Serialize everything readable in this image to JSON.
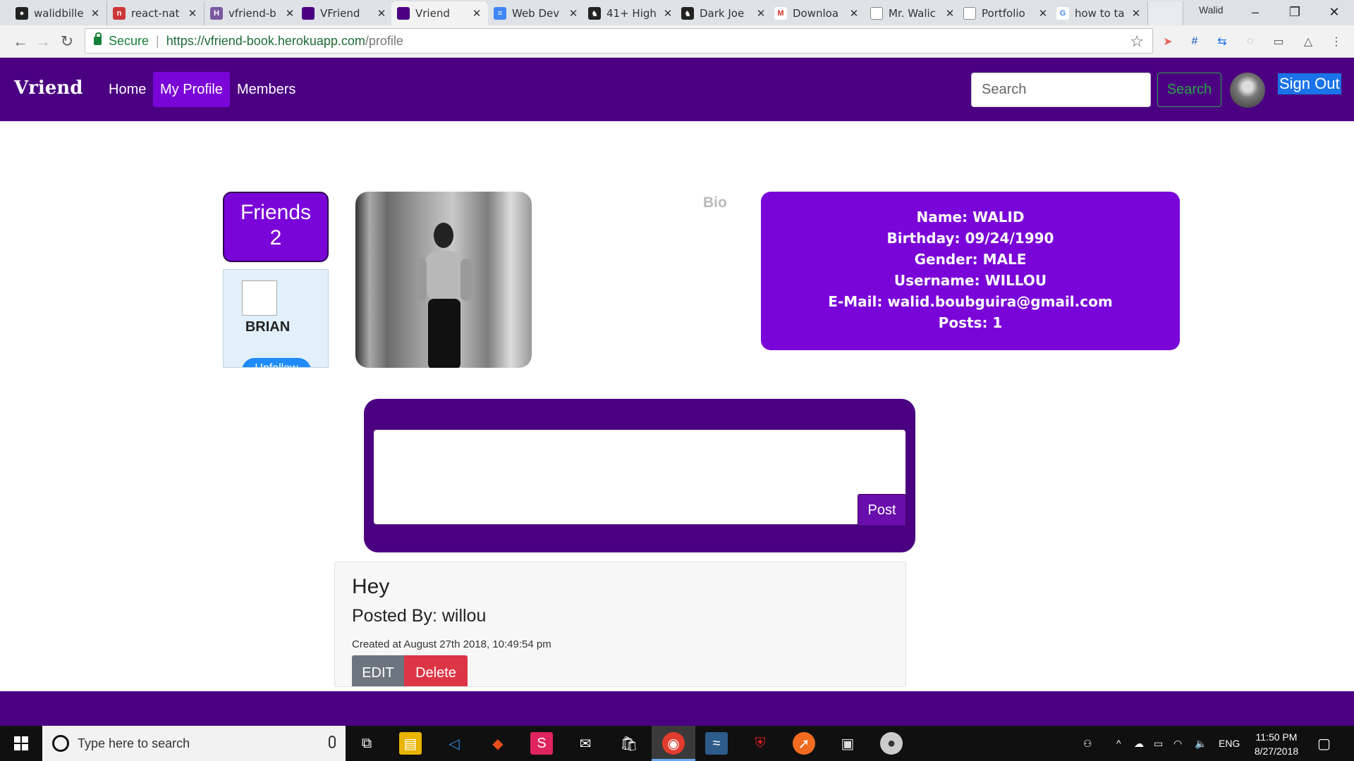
{
  "browser": {
    "tabs": [
      {
        "title": "walidbille",
        "favicon": "github-icon",
        "color": "#222222"
      },
      {
        "title": "react-nat",
        "favicon": "npm-icon",
        "color": "#cb3837"
      },
      {
        "title": "vfriend-b",
        "favicon": "heroku-icon",
        "color": "#79589f"
      },
      {
        "title": "VFriend",
        "favicon": "vfriend-icon",
        "color": "#4b0082"
      },
      {
        "title": "Vriend",
        "favicon": "vfriend-icon",
        "color": "#4b0082"
      },
      {
        "title": "Web Dev",
        "favicon": "docs-icon",
        "color": "#4285f4"
      },
      {
        "title": "41+ High",
        "favicon": "horse-icon",
        "color": "#222222"
      },
      {
        "title": "Dark Joe",
        "favicon": "horse-icon",
        "color": "#222222"
      },
      {
        "title": "Downloa",
        "favicon": "gmail-icon",
        "color": "#d93025"
      },
      {
        "title": "Mr. Walic",
        "favicon": "page-icon",
        "color": "#888888"
      },
      {
        "title": "Portfolio",
        "favicon": "page-icon",
        "color": "#888888"
      },
      {
        "title": "how to ta",
        "favicon": "google-icon",
        "color": "#4285f4"
      }
    ],
    "close_glyph": "✕",
    "profile_name": "Walid",
    "secure_label": "Secure",
    "url_main": "https://vfriend-book.herokuapp.com",
    "url_path": "/profile"
  },
  "nav": {
    "brand": "Vriend",
    "links": [
      "Home",
      "My Profile",
      "Members"
    ],
    "search_placeholder": "Search",
    "search_button": "Search",
    "signout": "Sign Out"
  },
  "friends": {
    "title": "Friends",
    "count": "2",
    "list": [
      {
        "name": "BRIAN",
        "action": "Unfollow"
      }
    ]
  },
  "bio": {
    "label": "Bio",
    "lines": [
      "Name: WALID",
      "Birthday: 09/24/1990",
      "Gender: MALE",
      "Username: WILLOU",
      "E-Mail: walid.boubguira@gmail.com",
      "Posts: 1"
    ]
  },
  "composer": {
    "post_button": "Post",
    "value": ""
  },
  "posts": [
    {
      "title": "Hey",
      "posted_by": "Posted By: willou",
      "created": "Created at August 27th 2018, 10:49:54 pm",
      "edit_label": "EDIT",
      "delete_label": "Delete"
    }
  ],
  "taskbar": {
    "search_placeholder": "Type here to search",
    "language": "ENG",
    "time": "11:50 PM",
    "date": "8/27/2018"
  },
  "colors": {
    "brand_purple": "#4b0082",
    "accent_purple": "#7a05d8",
    "search_green": "#28a745",
    "delete_red": "#dc3545"
  }
}
